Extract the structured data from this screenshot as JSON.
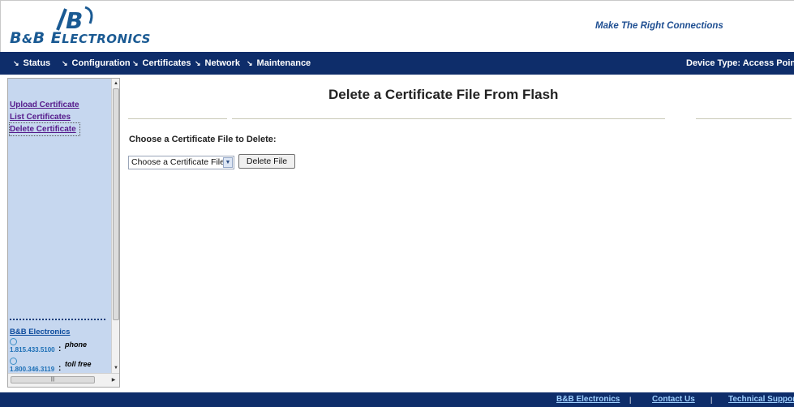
{
  "header": {
    "logo_text_big1": "B",
    "logo_text_amp": "&",
    "logo_text_big2": "B E",
    "logo_text_small": "LECTRONICS",
    "tagline": "Make The Right Connections"
  },
  "nav": {
    "items": [
      {
        "label": "Status"
      },
      {
        "label": "Configuration"
      },
      {
        "label": "Certificates"
      },
      {
        "label": "Network"
      },
      {
        "label": "Maintenance"
      }
    ],
    "device_type": "Device Type: Access Point",
    "arrow_icon": "down-arrow-icon"
  },
  "sidebar": {
    "links": [
      {
        "label": "Upload Certificate"
      },
      {
        "label": "List Certificates"
      },
      {
        "label": "Delete Certificate"
      }
    ],
    "contact": {
      "title": "B&B Electronics",
      "rows": [
        {
          "number": "1.815.433.5100",
          "label": "phone"
        },
        {
          "number": "1.800.346.3119",
          "label": "toll free"
        }
      ]
    }
  },
  "main": {
    "title": "Delete a Certificate File From Flash",
    "choose_label": "Choose a Certificate File to Delete:",
    "select_value": "Choose a Certificate File...",
    "delete_button": "Delete File"
  },
  "footer": {
    "links": [
      {
        "label": "B&B Electronics"
      },
      {
        "label": "Contact Us"
      },
      {
        "label": "Technical Support"
      }
    ]
  },
  "colors": {
    "nav_bg": "#0e2d6a",
    "sidebar_bg": "#c6d7ef",
    "logo_blue": "#1a5a93",
    "footer_link": "#9fd0ff"
  }
}
